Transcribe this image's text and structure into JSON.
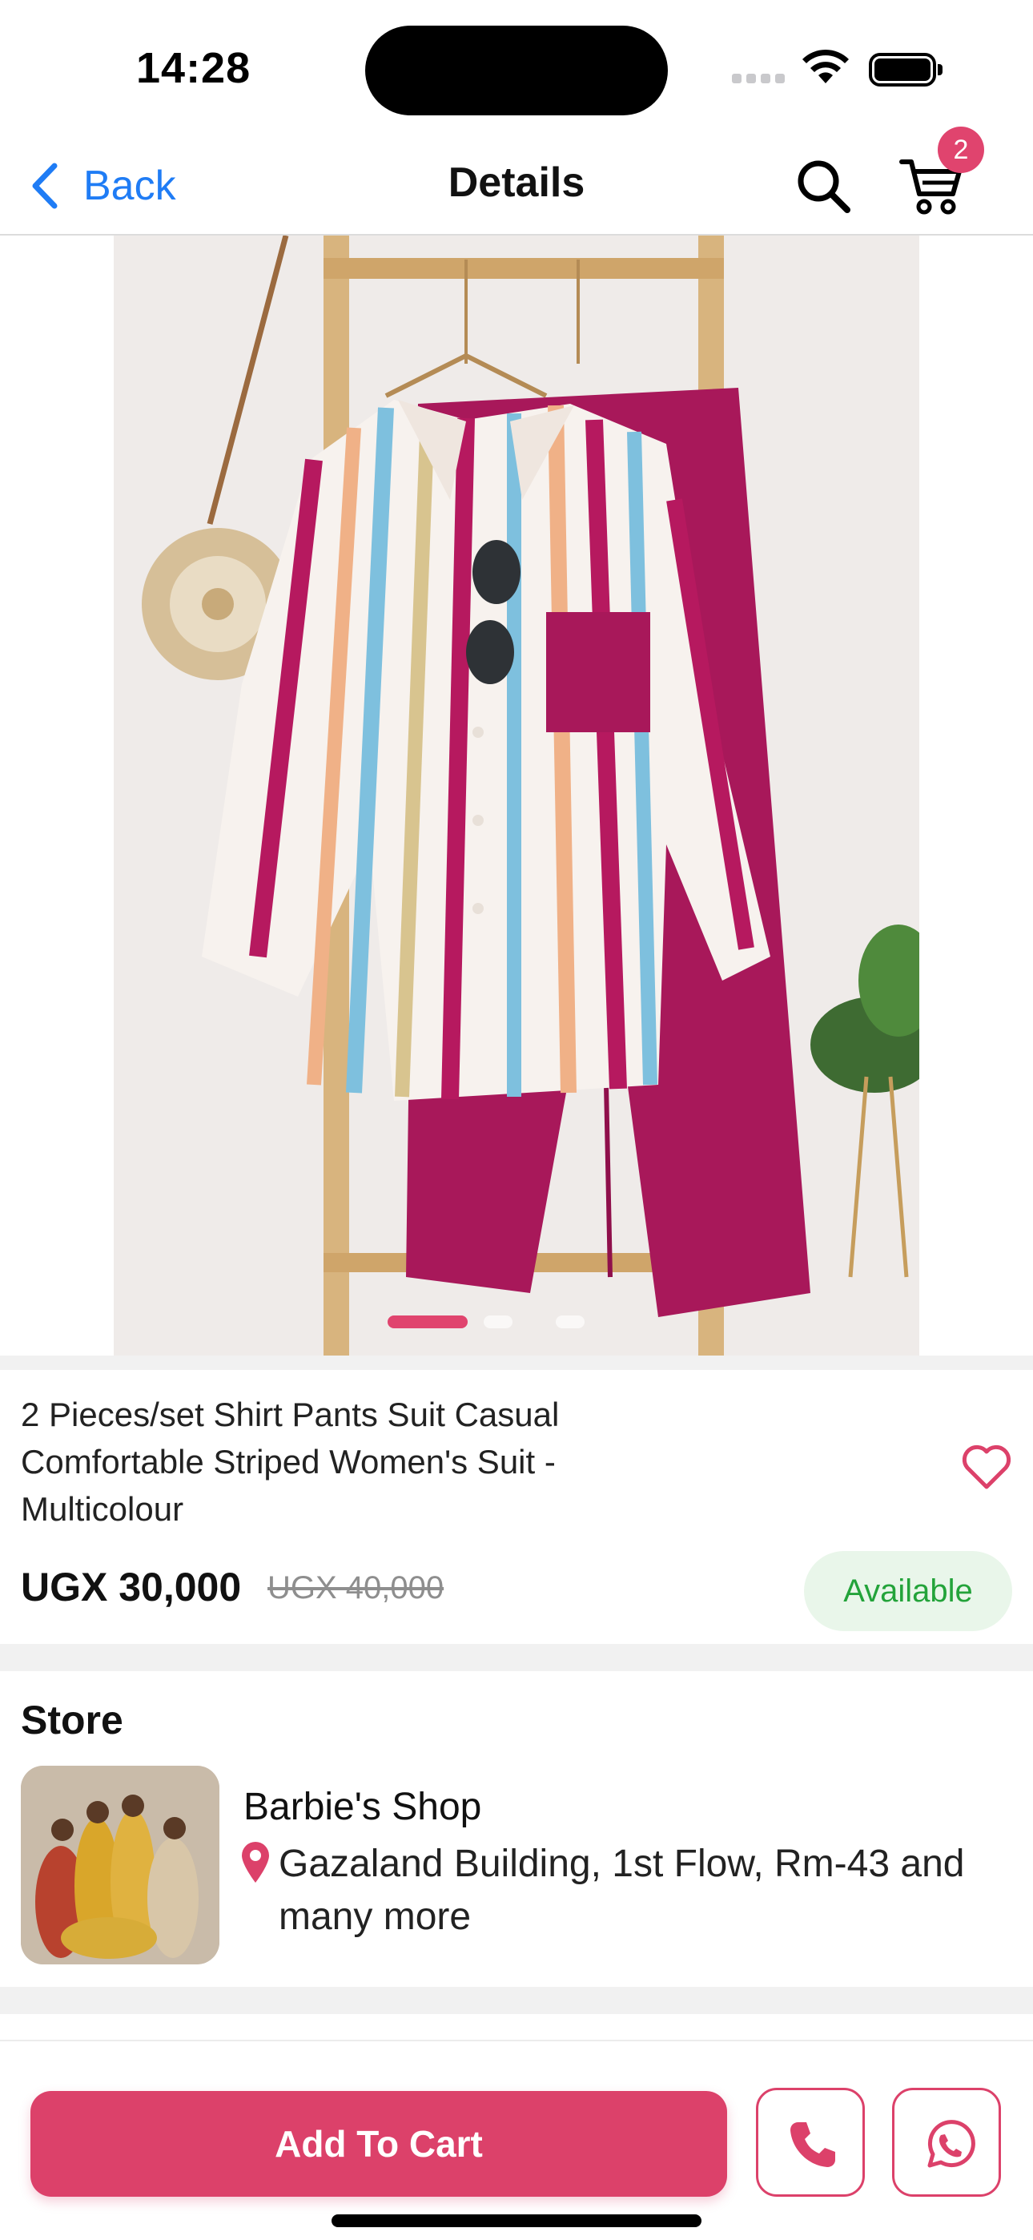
{
  "status_bar": {
    "time": "14:28",
    "icons": [
      "cellular-signal-icon",
      "wifi-icon",
      "battery-icon"
    ]
  },
  "nav": {
    "back_label": "Back",
    "title": "Details",
    "cart_count": "2",
    "icons": [
      "back-chevron-icon",
      "search-icon",
      "cart-icon"
    ]
  },
  "gallery": {
    "image_description_icon": "product-photo",
    "slide_count": 3,
    "active_slide": 1
  },
  "product": {
    "title": "2 Pieces/set Shirt Pants Suit Casual Comfortable Striped Women's Suit - Multicolour",
    "price": "UGX 30,000",
    "old_price": "UGX 40,000",
    "availability": "Available"
  },
  "store": {
    "heading": "Store",
    "name": "Barbie's Shop",
    "address": "Gazaland Building, 1st Flow, Rm-43 and many more"
  },
  "actions": {
    "add_to_cart": "Add To Cart",
    "icons": [
      "phone-icon",
      "whatsapp-icon"
    ]
  },
  "colors": {
    "accent": "#dc416a",
    "link_blue": "#1f7cf5",
    "available_green": "#23a33a",
    "available_bg": "#e9f6ea"
  }
}
